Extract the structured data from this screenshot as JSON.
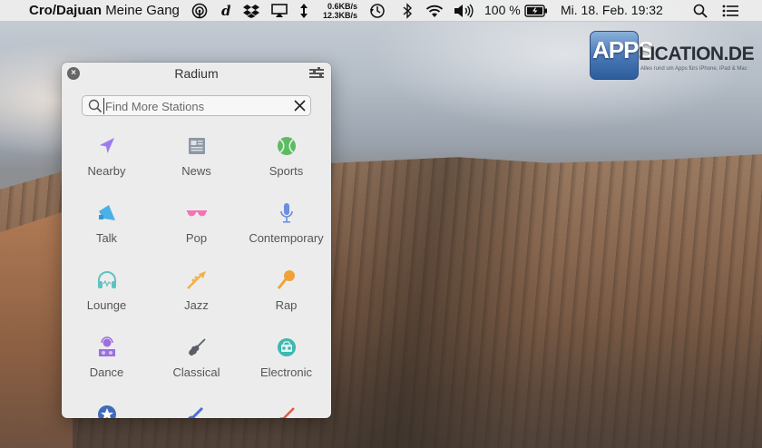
{
  "menubar": {
    "now_playing_artist": "Cro/Dajuan",
    "now_playing_title": "Meine Gang",
    "net_up": "0.6KB/s",
    "net_down": "12.3KB/s",
    "battery": "100 %",
    "datetime": "Mi. 18. Feb.  19:32",
    "icons": [
      "radium-icon",
      "dash-icon",
      "dropbox-icon",
      "airplay-icon",
      "netspeed-icon",
      "time-machine-icon",
      "bluetooth-icon",
      "wifi-icon",
      "volume-icon",
      "battery-icon",
      "spotlight-icon",
      "notification-center-icon"
    ]
  },
  "logo": {
    "apps": "APPS",
    "rest": "LICATION.DE",
    "tagline": "Alles rund um Apps fürs iPhone, iPad & Mac"
  },
  "popover": {
    "title": "Radium",
    "search_placeholder": "Find More Stations",
    "categories": [
      {
        "label": "Nearby",
        "icon": "location-arrow-icon",
        "color": "#9b7bef"
      },
      {
        "label": "News",
        "icon": "newspaper-icon",
        "color": "#8f98a4"
      },
      {
        "label": "Sports",
        "icon": "tennis-ball-icon",
        "color": "#5dbb63"
      },
      {
        "label": "Talk",
        "icon": "megaphone-icon",
        "color": "#4ab0e8"
      },
      {
        "label": "Pop",
        "icon": "sunglasses-icon",
        "color": "#f274b6"
      },
      {
        "label": "Contemporary",
        "icon": "microphone-icon",
        "color": "#6a8fe0"
      },
      {
        "label": "Lounge",
        "icon": "headphones-icon",
        "color": "#5ec3c1"
      },
      {
        "label": "Jazz",
        "icon": "trumpet-icon",
        "color": "#f0b24a"
      },
      {
        "label": "Rap",
        "icon": "hand-mic-icon",
        "color": "#f0a23a"
      },
      {
        "label": "Dance",
        "icon": "dj-icon",
        "color": "#9b6fe0"
      },
      {
        "label": "Classical",
        "icon": "violin-icon",
        "color": "#5a5e66"
      },
      {
        "label": "Electronic",
        "icon": "boombox-icon",
        "color": "#3fb8b0"
      },
      {
        "label": "",
        "icon": "star-icon",
        "color": "#3d6db8"
      },
      {
        "label": "",
        "icon": "guitar-icon",
        "color": "#4a6fd8"
      },
      {
        "label": "",
        "icon": "electric-guitar-icon",
        "color": "#e05a4a"
      }
    ]
  }
}
